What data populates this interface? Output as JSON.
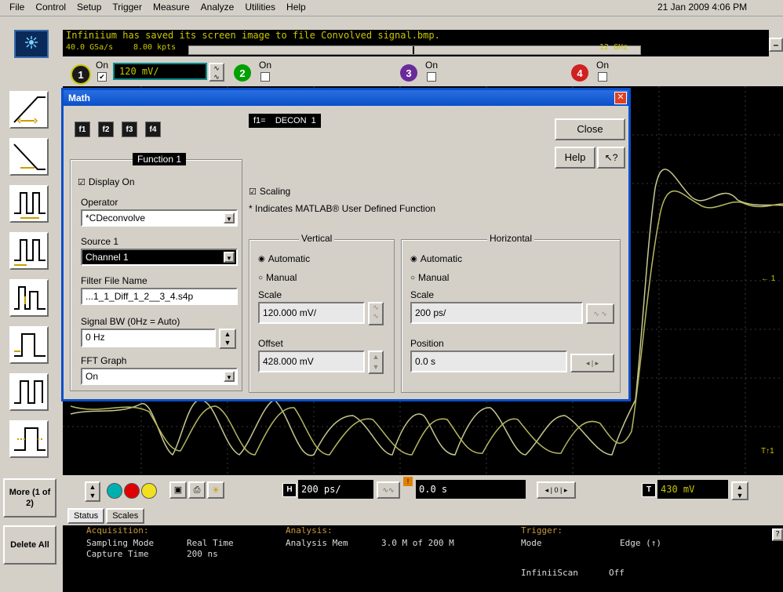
{
  "menu": {
    "items": [
      "File",
      "Control",
      "Setup",
      "Trigger",
      "Measure",
      "Analyze",
      "Utilities",
      "Help"
    ],
    "datetime": "21 Jan 2009  4:06 PM"
  },
  "top_bar": {
    "message": "Infiniium has saved its screen image to file Convolved signal.bmp.",
    "acq_rate": "40.0 GSa/s",
    "pts": "8.00 kpts",
    "bandwidth": "12 GHz",
    "minimize_label": "–"
  },
  "channels": [
    {
      "num": "1",
      "on_label": "On",
      "scale": "120 mV/",
      "color": "#c8c800"
    },
    {
      "num": "2",
      "on_label": "On",
      "color": "#00a000"
    },
    {
      "num": "3",
      "on_label": "On",
      "color": "#6a2a9a"
    },
    {
      "num": "4",
      "on_label": "On",
      "color": "#d02020"
    }
  ],
  "math_dialog": {
    "title": "Math",
    "func_tabs": [
      "f1",
      "f2",
      "f3",
      "f4"
    ],
    "func_expr": "f1=    DECON  1",
    "close_label": "Close",
    "help_label": "Help",
    "whats_this_label": "?",
    "function_title": "Function 1",
    "display_on_label": "Display On",
    "operator_label": "Operator",
    "operator_value": "*CDeconvolve",
    "source_label": "Source 1",
    "source_value": "Channel 1",
    "filter_label": "Filter File Name",
    "filter_value": "...1_1_Diff_1_2__3_4.s4p",
    "signal_bw_label": "Signal BW (0Hz = Auto)",
    "signal_bw_value": "0 Hz",
    "fft_label": "FFT Graph",
    "fft_value": "On",
    "scaling_label": "Scaling",
    "matlab_note": "* Indicates MATLAB® User Defined Function",
    "vertical": {
      "title": "Vertical",
      "auto_label": "Automatic",
      "manual_label": "Manual",
      "scale_label": "Scale",
      "scale_value": "120.000 mV/",
      "offset_label": "Offset",
      "offset_value": "428.000 mV"
    },
    "horizontal": {
      "title": "Horizontal",
      "auto_label": "Automatic",
      "manual_label": "Manual",
      "scale_label": "Scale",
      "scale_value": "200 ps/",
      "position_label": "Position",
      "position_value": "0.0 s"
    }
  },
  "bottom_controls": {
    "timebase": "200 ps/",
    "delay": "0.0 s",
    "trigger_level": "430 mV",
    "h_label": "H",
    "t_label": "T"
  },
  "left_buttons": {
    "more_label": "More (1 of 2)",
    "delete_label": "Delete All"
  },
  "status": {
    "tabs": [
      "Status",
      "Scales"
    ],
    "acq_title": "Acquisition:",
    "sampling_mode_label": "Sampling Mode",
    "sampling_mode_value": "Real Time",
    "capture_time_label": "Capture Time",
    "capture_time_value": "200 ns",
    "analysis_title": "Analysis:",
    "analysis_mem_label": "Analysis Mem",
    "analysis_mem_value": "3.0 M of 200 M",
    "trigger_title": "Trigger:",
    "trig_mode_label": "Mode",
    "trig_mode_value": "Edge (↑)",
    "infiniscan_label": "InfiniiScan",
    "infiniscan_value": "Off",
    "right_help": "?"
  },
  "colors": {
    "accent": "#c8c800",
    "dialog_title": "#0a4fc9",
    "screen_bg": "#000000",
    "status_text": "#c89a3a"
  }
}
